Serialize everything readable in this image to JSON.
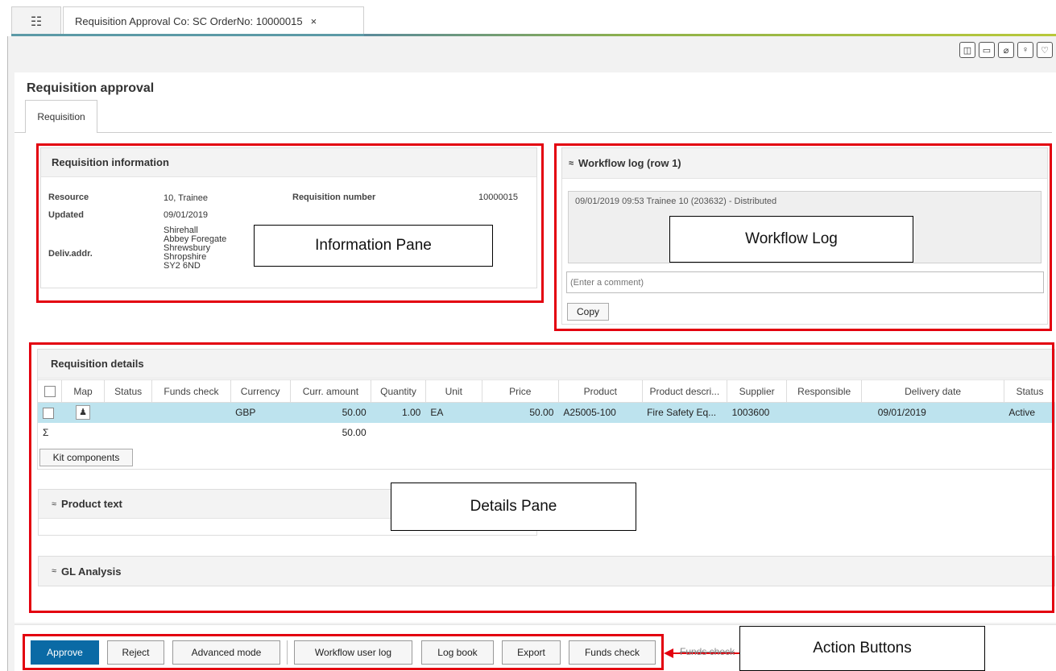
{
  "tab": {
    "menu_icon": "list-menu-icon",
    "title": "Requisition Approval Co: SC OrderNo: 10000015",
    "close": "×"
  },
  "toolbar_icons": [
    "split-view-icon",
    "comment-icon",
    "attachment-icon",
    "lightbulb-icon",
    "favorite-heart-icon"
  ],
  "page": {
    "title": "Requisition approval",
    "tab_label": "Requisition"
  },
  "info": {
    "title": "Requisition information",
    "resource_label": "Resource",
    "resource_value": "10, Trainee",
    "updated_label": "Updated",
    "updated_value": "09/01/2019",
    "req_number_label": "Requisition number",
    "req_number_value": "10000015",
    "deliv_label": "Deliv.addr.",
    "deliv_lines": [
      "Shirehall",
      "Abbey Foregate",
      "Shrewsbury",
      "Shropshire",
      "SY2 6ND"
    ]
  },
  "workflow": {
    "title": "Workflow log (row 1)",
    "entry": "09/01/2019 09:53 Trainee 10 (203632) - Distributed",
    "comment_placeholder": "(Enter a comment)",
    "copy_label": "Copy"
  },
  "details": {
    "title": "Requisition details",
    "columns": [
      "Map",
      "Status",
      "Funds check",
      "Currency",
      "Curr. amount",
      "Quantity",
      "Unit",
      "Price",
      "Product",
      "Product descri...",
      "Supplier",
      "Responsible",
      "Delivery date",
      "Status"
    ],
    "row": {
      "currency": "GBP",
      "amount": "50.00",
      "quantity": "1.00",
      "unit": "EA",
      "price": "50.00",
      "product": "A25005-100",
      "description": "Fire Safety Eq...",
      "supplier": "1003600",
      "responsible": "",
      "delivery_date": "09/01/2019",
      "status": "Active"
    },
    "sum_symbol": "Σ",
    "sum_amount": "50.00",
    "kit_label": "Kit components",
    "product_text_label": "Product text",
    "gl_label": "GL Analysis"
  },
  "actions": {
    "approve": "Approve",
    "reject": "Reject",
    "advanced": "Advanced mode",
    "workflow_log": "Workflow user log",
    "log_book": "Log book",
    "export": "Export",
    "funds_check": "Funds check",
    "funds_check_struck": "Funds check"
  },
  "callouts": {
    "info": "Information Pane",
    "workflow": "Workflow Log",
    "details": "Details Pane",
    "actions": "Action Buttons"
  },
  "colors": {
    "approve_bg": "#0a6aa5",
    "selected_row": "#bde3ee",
    "highlight": "#e3000f"
  }
}
